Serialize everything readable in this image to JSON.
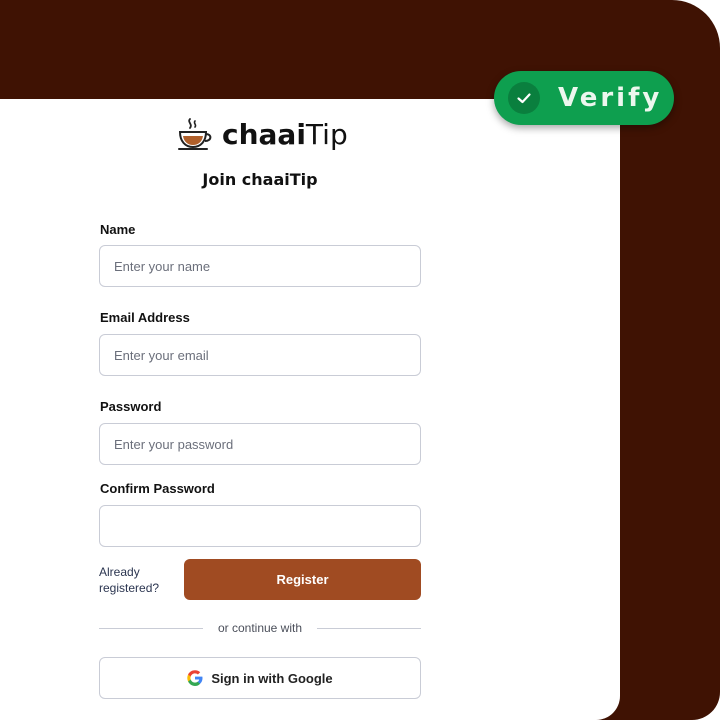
{
  "brand": {
    "name_bold": "chaai",
    "name_regular": "Tip",
    "icon": "chai-cup-icon"
  },
  "verify_badge": {
    "label": "Verify",
    "icon": "check-icon"
  },
  "form": {
    "heading": "Join chaaiTip",
    "fields": [
      {
        "label": "Name",
        "placeholder": "Enter your name",
        "value": ""
      },
      {
        "label": "Email Address",
        "placeholder": "Enter your email",
        "value": ""
      },
      {
        "label": "Password",
        "placeholder": "Enter your password",
        "value": ""
      },
      {
        "label": "Confirm Password",
        "placeholder": "",
        "value": ""
      }
    ],
    "already_registered": "Already registered?",
    "register_button": "Register",
    "divider_text": "or continue with",
    "google_button": "Sign in with Google"
  },
  "colors": {
    "background_frame": "#3f1203",
    "register_button": "#a04b22",
    "verify_badge": "#0e9f4f"
  }
}
